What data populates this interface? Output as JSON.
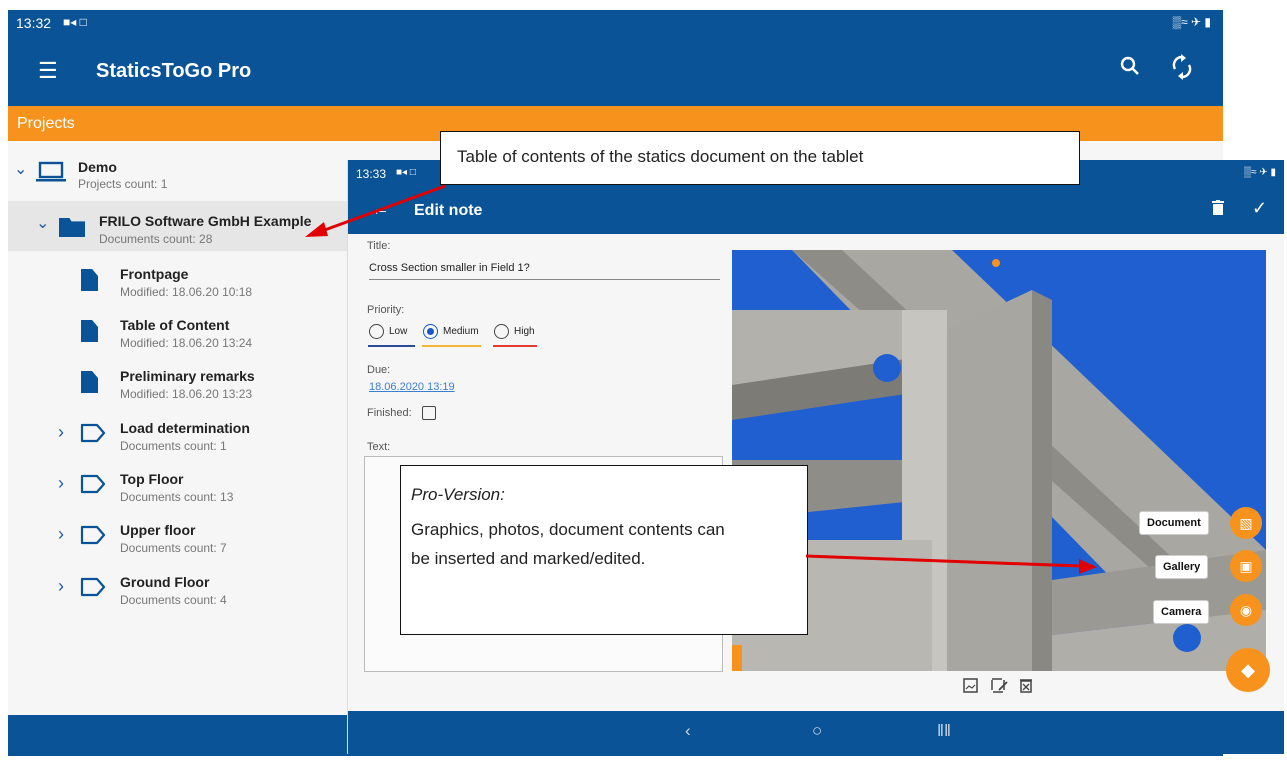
{
  "back_tablet": {
    "status_time": "13:32",
    "status_icons_left": "■◂ □",
    "status_icons_right": "▒≈ ✈ ▮",
    "app_title": "StaticsToGo Pro",
    "section_title": "Projects",
    "tree": [
      {
        "kind": "project",
        "name": "Demo",
        "sub": "Projects count: 1"
      },
      {
        "kind": "folder",
        "name": "FRILO Software GmbH Example",
        "sub": "Documents count: 28",
        "selected": true
      },
      {
        "kind": "doc",
        "name": "Frontpage",
        "sub": "Modified: 18.06.20 10:18"
      },
      {
        "kind": "doc",
        "name": "Table of Content",
        "sub": "Modified: 18.06.20 13:24"
      },
      {
        "kind": "doc",
        "name": "Preliminary remarks",
        "sub": "Modified: 18.06.20 13:23"
      },
      {
        "kind": "group",
        "name": "Load determination",
        "sub": "Documents count: 1"
      },
      {
        "kind": "group",
        "name": "Top Floor",
        "sub": "Documents count: 13"
      },
      {
        "kind": "group",
        "name": "Upper floor",
        "sub": "Documents count: 7"
      },
      {
        "kind": "group",
        "name": "Ground Floor",
        "sub": "Documents count: 4"
      }
    ]
  },
  "front_tablet": {
    "status_time": "13:33",
    "status_icons_left": "■◂ □",
    "status_icons_right": "▒≈ ✈ ▮",
    "screen_title": "Edit note",
    "form": {
      "title_label": "Title:",
      "title_value": "Cross Section smaller in Field 1?",
      "priority_label": "Priority:",
      "priority_options": [
        "Low",
        "Medium",
        "High"
      ],
      "priority_selected": "Medium",
      "priority_colors": [
        "#2b4a9a",
        "#f2b63c",
        "#e53935"
      ],
      "due_label": "Due:",
      "due_value": "18.06.2020 13:19",
      "finished_label": "Finished:",
      "finished_checked": false,
      "text_label": "Text:",
      "text_value": ""
    },
    "insert_actions": [
      "Document",
      "Gallery",
      "Camera"
    ],
    "image_tools": [
      "image-icon",
      "edit-image-icon",
      "delete-image-icon"
    ]
  },
  "callouts": {
    "toc": "Table of contents of the statics document on the tablet",
    "pro_heading": "Pro-Version:",
    "pro_body": "Graphics, photos, document contents can be inserted and marked/edited."
  },
  "colors": {
    "primary": "#0a5396",
    "accent": "#f7931d",
    "arrow": "#e00000"
  }
}
